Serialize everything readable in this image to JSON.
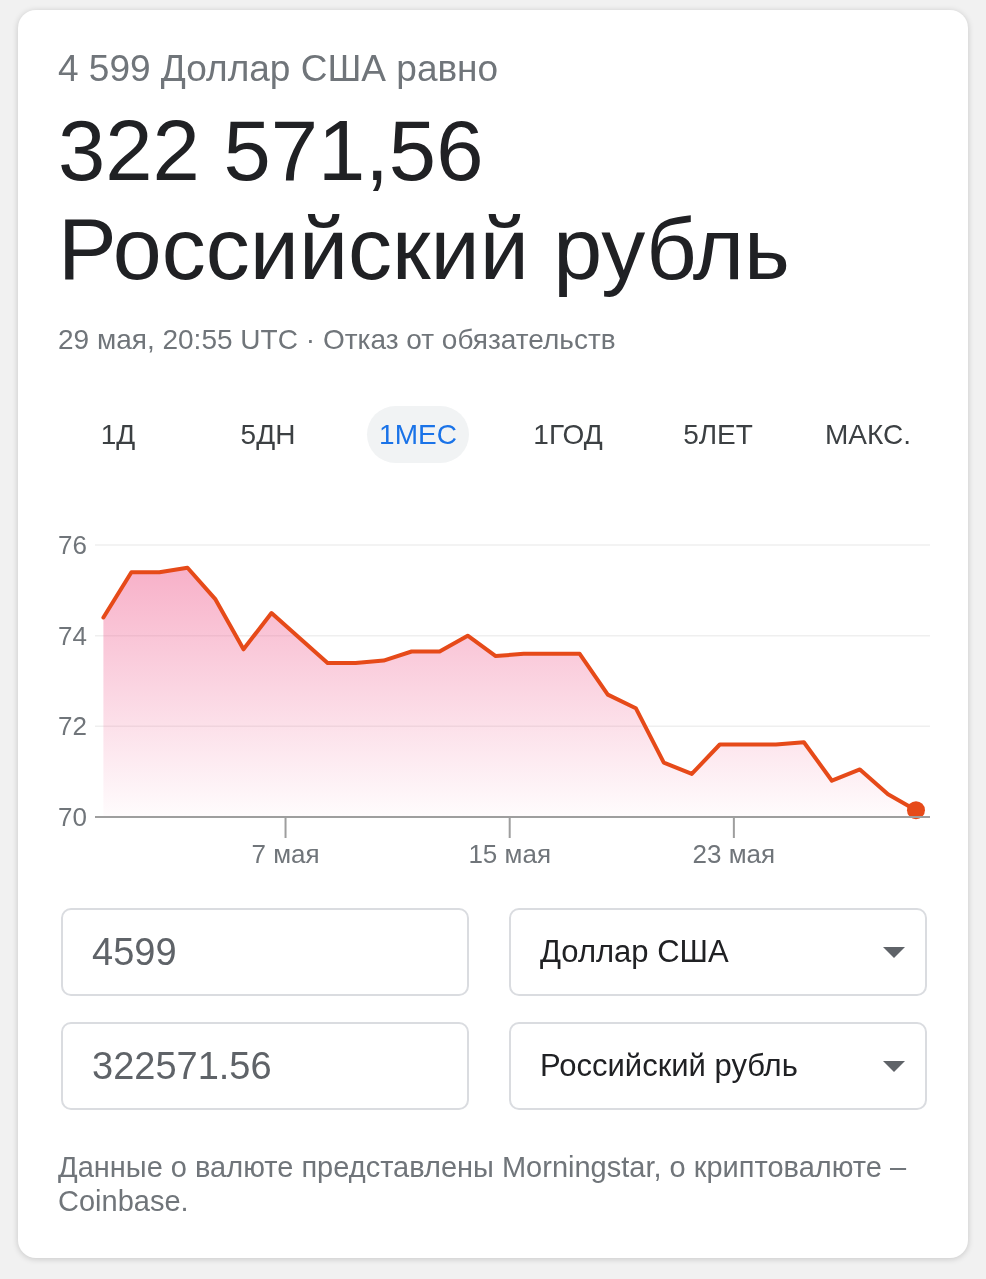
{
  "conversion": {
    "summary": "4 599 Доллар США равно",
    "result_amount": "322 571,56",
    "result_currency": "Российский рубль",
    "timestamp": "29 мая, 20:55 UTC ·",
    "disclaimer_link": "Отказ от обязательств"
  },
  "ranges": [
    {
      "label": "1Д",
      "selected": false
    },
    {
      "label": "5ДН",
      "selected": false
    },
    {
      "label": "1МЕС",
      "selected": true
    },
    {
      "label": "1ГОД",
      "selected": false
    },
    {
      "label": "5ЛЕТ",
      "selected": false
    },
    {
      "label": "МАКС.",
      "selected": false
    }
  ],
  "chart": {
    "chart_data": {
      "type": "area",
      "x": [
        0,
        1,
        2,
        3,
        4,
        5,
        6,
        7,
        8,
        9,
        10,
        11,
        12,
        13,
        14,
        15,
        16,
        17,
        18,
        19,
        20,
        21,
        22,
        23,
        24,
        25,
        26,
        27,
        28,
        29
      ],
      "series": [
        {
          "color": "#e64a19",
          "values": [
            74.4,
            75.4,
            75.4,
            75.5,
            74.8,
            73.7,
            74.5,
            73.95,
            73.4,
            73.4,
            73.45,
            73.65,
            73.65,
            74.0,
            73.55,
            73.6,
            73.6,
            73.6,
            72.7,
            72.4,
            71.2,
            70.95,
            71.6,
            71.6,
            71.6,
            71.65,
            70.8,
            71.05,
            70.5,
            70.15
          ]
        }
      ],
      "xlim": [
        -0.3,
        29.5
      ],
      "ylim": [
        70,
        76
      ],
      "xticks": [
        {
          "value": 6.5,
          "label": "7 мая"
        },
        {
          "value": 14.5,
          "label": "15 мая"
        },
        {
          "value": 22.5,
          "label": "23 мая"
        }
      ],
      "yticks": [
        70,
        72,
        74,
        76
      ]
    }
  },
  "converter": {
    "rows": [
      {
        "amount": "4599",
        "currency": "Доллар США"
      },
      {
        "amount": "322571.56",
        "currency": "Российский рубль"
      }
    ]
  },
  "source_note": "Данные о валюте представлены Morningstar, о криптовалюте – Coinbase."
}
